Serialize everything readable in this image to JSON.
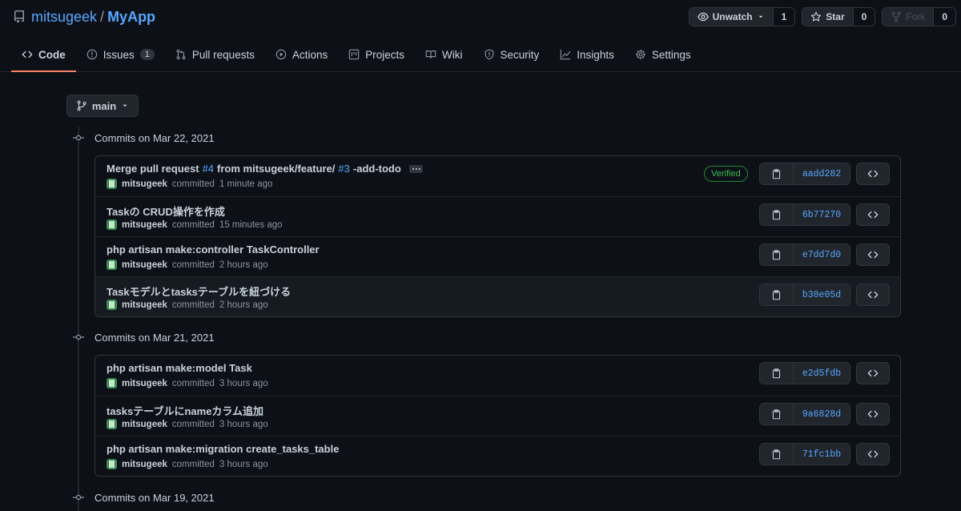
{
  "repo": {
    "owner": "mitsugeek",
    "separator": "/",
    "name": "MyApp"
  },
  "actions": {
    "watch": {
      "label": "Unwatch",
      "count": "1"
    },
    "star": {
      "label": "Star",
      "count": "0"
    },
    "fork": {
      "label": "Fork",
      "count": "0"
    }
  },
  "tabs": [
    {
      "label": "Code"
    },
    {
      "label": "Issues",
      "badge": "1"
    },
    {
      "label": "Pull requests"
    },
    {
      "label": "Actions"
    },
    {
      "label": "Projects"
    },
    {
      "label": "Wiki"
    },
    {
      "label": "Security"
    },
    {
      "label": "Insights"
    },
    {
      "label": "Settings"
    }
  ],
  "branch": {
    "label": "main"
  },
  "days": [
    {
      "heading": "Commits on Mar 22, 2021",
      "commits": [
        {
          "message_parts": [
            "Merge pull request ",
            "#4",
            " from mitsugeek/feature/",
            "#3",
            "-add-todo"
          ],
          "author": "mitsugeek",
          "verb": "committed",
          "time": "1 minute ago",
          "verified": "Verified",
          "sha": "aadd282"
        },
        {
          "message": "Taskの CRUD操作を作成",
          "author": "mitsugeek",
          "verb": "committed",
          "time": "15 minutes ago",
          "sha": "6b77270"
        },
        {
          "message": "php artisan make:controller TaskController",
          "author": "mitsugeek",
          "verb": "committed",
          "time": "2 hours ago",
          "sha": "e7dd7d0"
        },
        {
          "message": "Taskモデルとtasksテーブルを紐づける",
          "author": "mitsugeek",
          "verb": "committed",
          "time": "2 hours ago",
          "sha": "b30e05d"
        }
      ]
    },
    {
      "heading": "Commits on Mar 21, 2021",
      "commits": [
        {
          "message": "php artisan make:model Task",
          "author": "mitsugeek",
          "verb": "committed",
          "time": "3 hours ago",
          "sha": "e2d5fdb"
        },
        {
          "message": "tasksテーブルにnameカラム追加",
          "author": "mitsugeek",
          "verb": "committed",
          "time": "3 hours ago",
          "sha": "9a6828d"
        },
        {
          "message": "php artisan make:migration create_tasks_table",
          "author": "mitsugeek",
          "verb": "committed",
          "time": "3 hours ago",
          "sha": "71fc1bb"
        }
      ]
    },
    {
      "heading": "Commits on Mar 19, 2021",
      "commits": []
    }
  ]
}
